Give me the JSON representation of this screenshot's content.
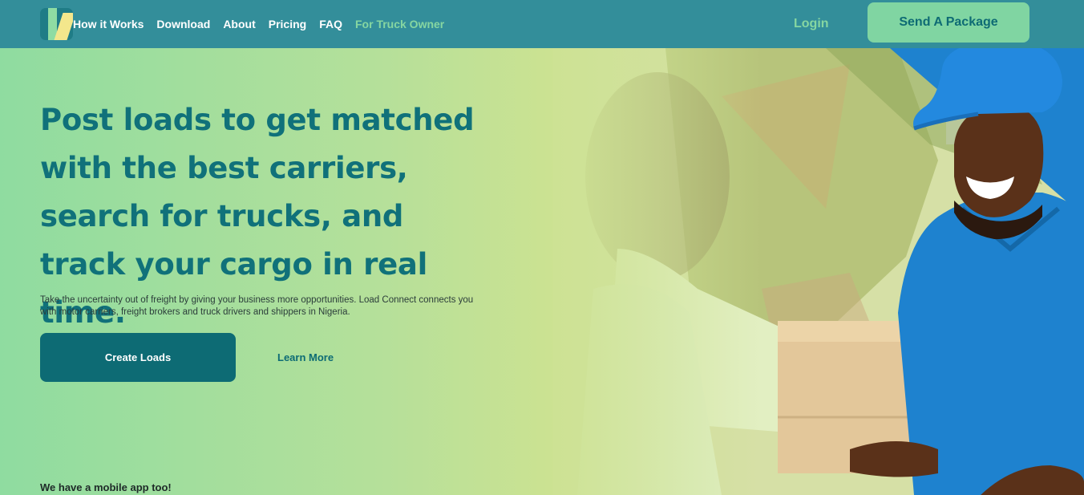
{
  "nav": {
    "links": [
      "How it Works",
      "Download",
      "About",
      "Pricing",
      "FAQ"
    ],
    "truck_owner": "For Truck Owner",
    "login": "Login",
    "send_package": "Send A Package"
  },
  "hero": {
    "headline": "Post loads to get matched with the best carriers, search for trucks, and track your cargo in real time.",
    "subtext": "Take the uncertainty out of freight by giving your business more opportunities. Load Connect connects you with motor carriers, freight brokers and truck drivers and shippers in Nigeria.",
    "create_loads": "Create Loads",
    "learn_more": "Learn More",
    "mobile_note": "We have a mobile app too!"
  },
  "colors": {
    "nav_bg": "#338e9a",
    "accent_green": "#80d5a2",
    "heading_teal": "#10717a",
    "button_teal": "#0d6b74"
  },
  "icons": [
    "logo-icon"
  ]
}
